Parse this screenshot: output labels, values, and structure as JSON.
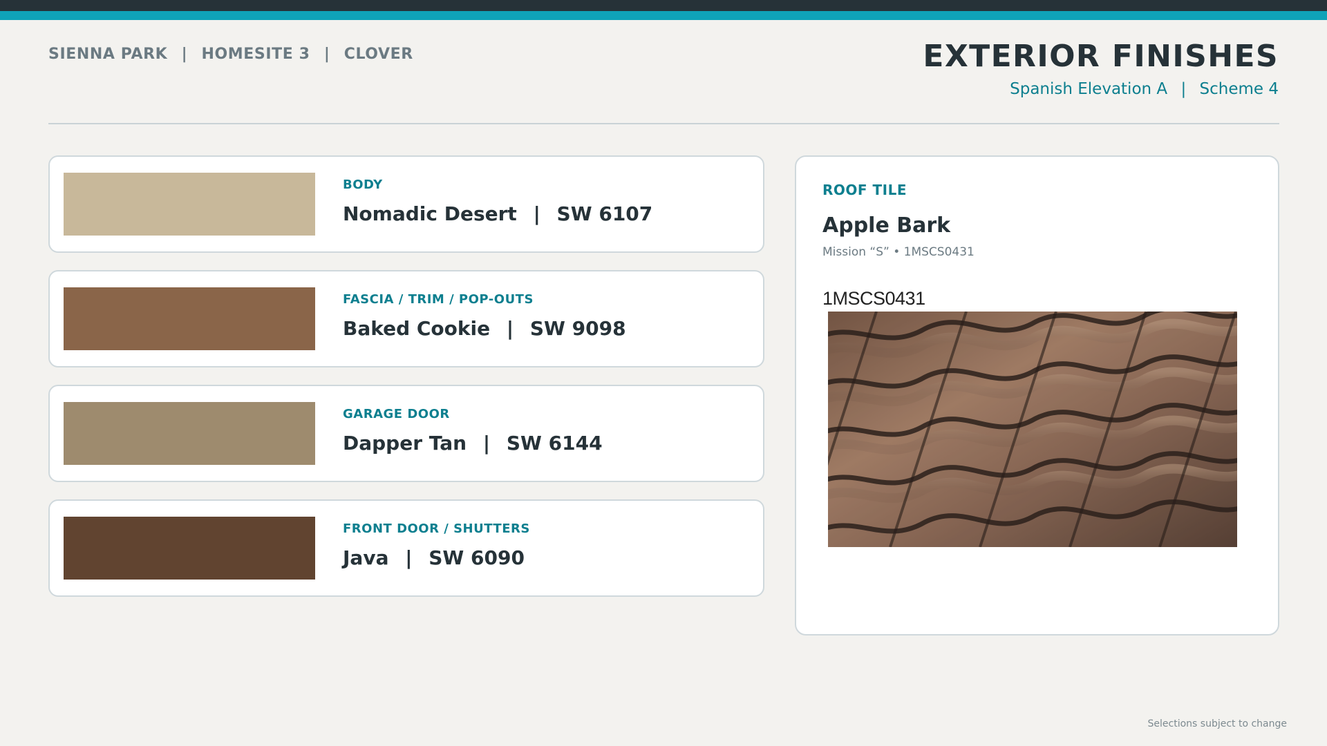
{
  "header": {
    "breadcrumb": [
      "SIENNA PARK",
      "HOMESITE 3",
      "CLOVER"
    ],
    "breadcrumb_separator": "|",
    "title": "EXTERIOR FINISHES",
    "subtitle_parts": [
      "Spanish Elevation A",
      "Scheme 4"
    ],
    "subtitle_separator": "|"
  },
  "paints": [
    {
      "label": "BODY",
      "color_name": "Nomadic Desert",
      "code": "SW 6107",
      "swatch_color": "#c8b89a"
    },
    {
      "label": "FASCIA / TRIM / POP-OUTS",
      "color_name": "Baked Cookie",
      "code": "SW 9098",
      "swatch_color": "#8a6549"
    },
    {
      "label": "GARAGE DOOR",
      "color_name": "Dapper Tan",
      "code": "SW 6144",
      "swatch_color": "#9e8b6e"
    },
    {
      "label": "FRONT DOOR / SHUTTERS",
      "color_name": "Java",
      "code": "SW 6090",
      "swatch_color": "#614430"
    }
  ],
  "value_separator": "|",
  "roof": {
    "label": "ROOF TILE",
    "name": "Apple Bark",
    "detail": "Mission “S” • 1MSCS0431",
    "photo_caption": "1MSCS0431",
    "photo_icon": "roof-tile-photo"
  },
  "footer": {
    "note": "Selections subject to change"
  },
  "colors": {
    "accent": "#0fa3b8",
    "accent_text": "#0d7f8f",
    "dark": "#263238",
    "muted": "#6b7a82",
    "background": "#f3f2ef"
  }
}
